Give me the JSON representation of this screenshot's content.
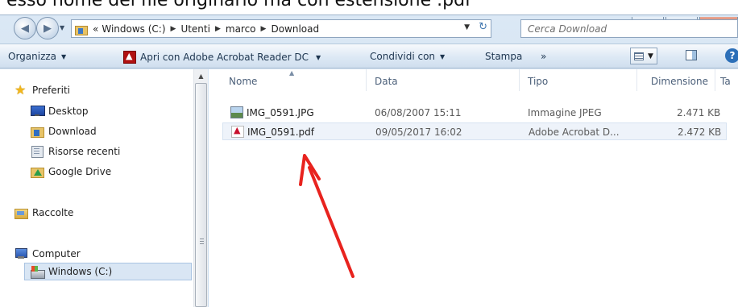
{
  "caption": "esso nome del file originario ma con estensione .pdf",
  "address": {
    "lead": "«",
    "crumbs": [
      "Windows (C:)",
      "Utenti",
      "marco",
      "Download"
    ],
    "search_placeholder": "Cerca Download"
  },
  "toolbar": {
    "organize": "Organizza",
    "open_with": "Apri con Adobe Acrobat Reader DC",
    "share": "Condividi con",
    "print": "Stampa",
    "more": "»",
    "help": "?"
  },
  "nav": {
    "favorites": "Preferiti",
    "desktop": "Desktop",
    "download": "Download",
    "recent": "Risorse recenti",
    "gdrive": "Google Drive",
    "libraries": "Raccolte",
    "computer": "Computer",
    "drive_c": "Windows (C:)"
  },
  "columns": {
    "name": "Nome",
    "date": "Data",
    "type": "Tipo",
    "size": "Dimensione",
    "tags": "Ta"
  },
  "files": [
    {
      "name": "IMG_0591.JPG",
      "date": "06/08/2007 15:11",
      "type": "Immagine JPEG",
      "size": "2.471 KB",
      "icon": "jpg-file-icon"
    },
    {
      "name": "IMG_0591.pdf",
      "date": "09/05/2017 16:02",
      "type": "Adobe Acrobat D...",
      "size": "2.472 KB",
      "icon": "pdf-file-icon"
    }
  ],
  "colors": {
    "annotation_arrow": "#e8231e",
    "toolbar_text": "#1e3650",
    "header_text": "#4c607a",
    "selection_bg": "#d9e6f4"
  }
}
